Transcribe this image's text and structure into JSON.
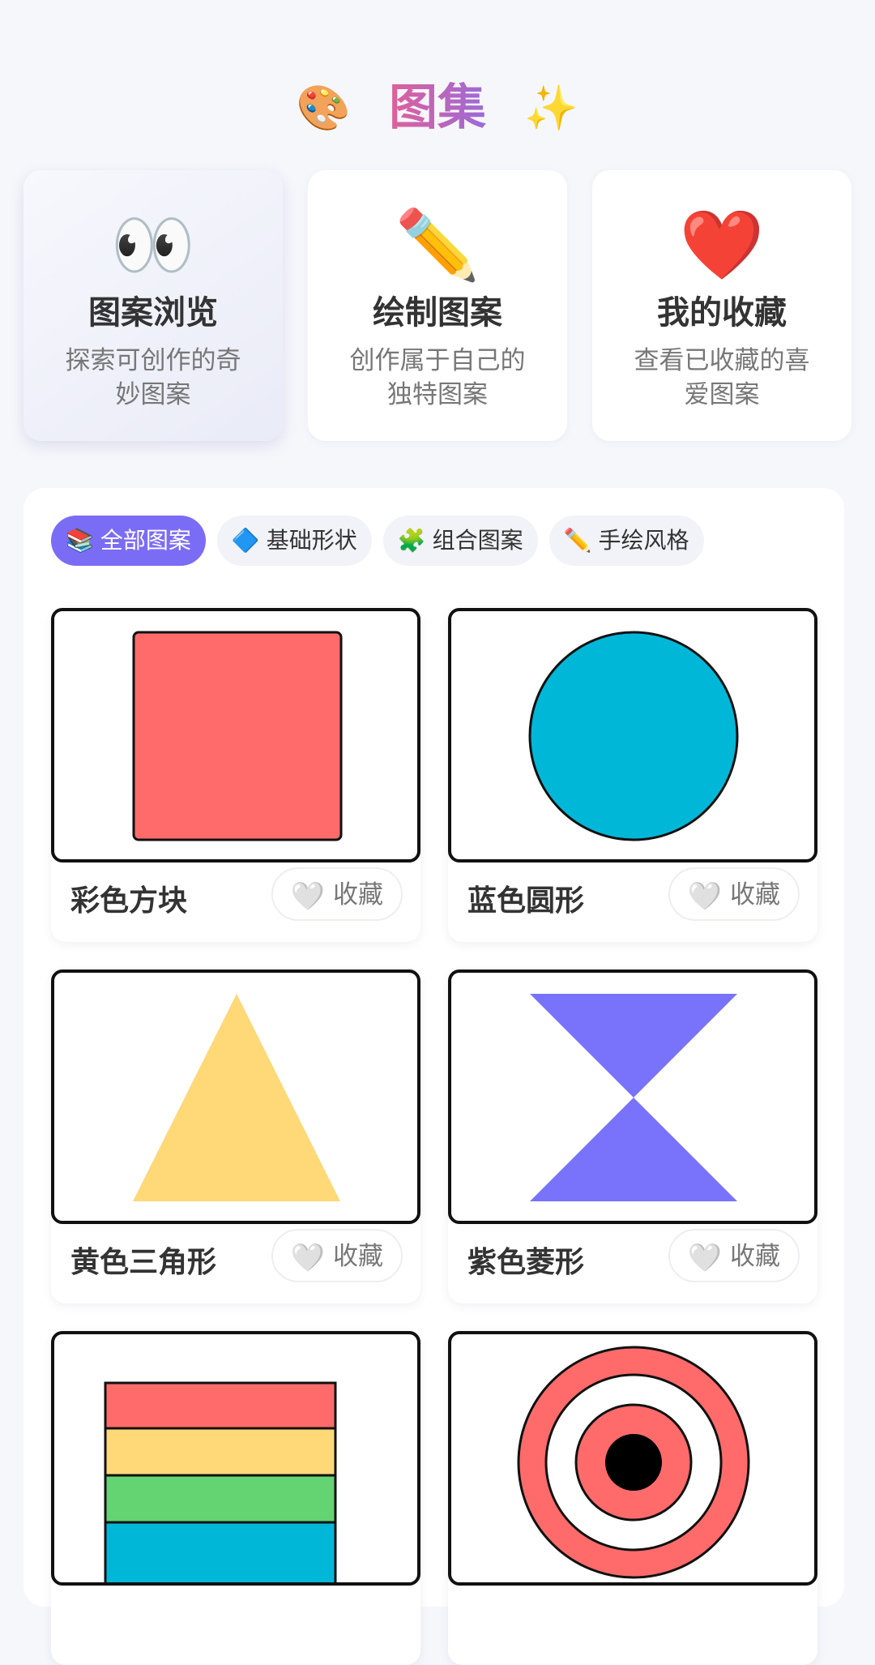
{
  "header": {
    "title": "图集",
    "left_icon": "🎨",
    "right_icon": "✨"
  },
  "features": [
    {
      "icon": "👀",
      "title": "图案浏览",
      "desc": "探索可创作的奇妙图案"
    },
    {
      "icon": "✏️",
      "title": "绘制图案",
      "desc": "创作属于自己的独特图案"
    },
    {
      "icon": "❤️",
      "title": "我的收藏",
      "desc": "查看已收藏的喜爱图案"
    }
  ],
  "tabs": [
    {
      "icon": "📚",
      "label": "全部图案"
    },
    {
      "icon": "🔷",
      "label": "基础形状"
    },
    {
      "icon": "🧩",
      "label": "组合图案"
    },
    {
      "icon": "✏️",
      "label": "手绘风格"
    }
  ],
  "cards": [
    {
      "name": "彩色方块",
      "fav_label": "收藏",
      "fav_icon": "🤍"
    },
    {
      "name": "蓝色圆形",
      "fav_label": "收藏",
      "fav_icon": "🤍"
    },
    {
      "name": "黄色三角形",
      "fav_label": "收藏",
      "fav_icon": "🤍"
    },
    {
      "name": "紫色菱形",
      "fav_label": "收藏",
      "fav_icon": "🤍"
    },
    {
      "name": "",
      "fav_label": "",
      "fav_icon": ""
    },
    {
      "name": "",
      "fav_label": "",
      "fav_icon": ""
    }
  ],
  "colors": {
    "accent": "#7b6cf6",
    "red": "#ff6b6b",
    "blue": "#00b7d8",
    "yellow": "#ffd878",
    "purple": "#7873fa",
    "green": "#63d471"
  }
}
